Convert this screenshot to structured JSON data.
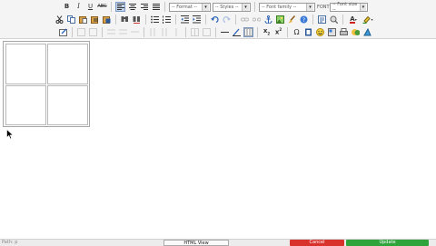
{
  "toolbar": {
    "bold": "B",
    "italic": "I",
    "underline": "U",
    "strike": "ABC",
    "format_select": "-- Format --",
    "styles_select": "-- Styles --",
    "font_family_select": "-- Font family --",
    "font_label": "FONT",
    "font_size_select": "-- Font size --",
    "arrow": "▾",
    "font_color": "A"
  },
  "footer": {
    "status": "Path: p",
    "html_view": "HTML View",
    "cancel": "Cancel",
    "update": "Update"
  },
  "colors": {
    "toolbar_bg": "#f4f4f4",
    "active_bg": "#c2d3ea",
    "cancel": "#d9312b",
    "update": "#2fa43a"
  },
  "icons": [
    "cut-icon",
    "copy-icon",
    "paste-icon",
    "paste-text-icon",
    "paste-word-icon",
    "find-icon",
    "replace-icon",
    "bullet-list-icon",
    "numbered-list-icon",
    "outdent-icon",
    "indent-icon",
    "undo-icon",
    "redo-icon",
    "link-icon",
    "unlink-icon",
    "anchor-icon",
    "image-icon",
    "cleanup-icon",
    "help-icon",
    "source-icon",
    "preview-icon",
    "font-color-icon",
    "highlight-icon"
  ]
}
